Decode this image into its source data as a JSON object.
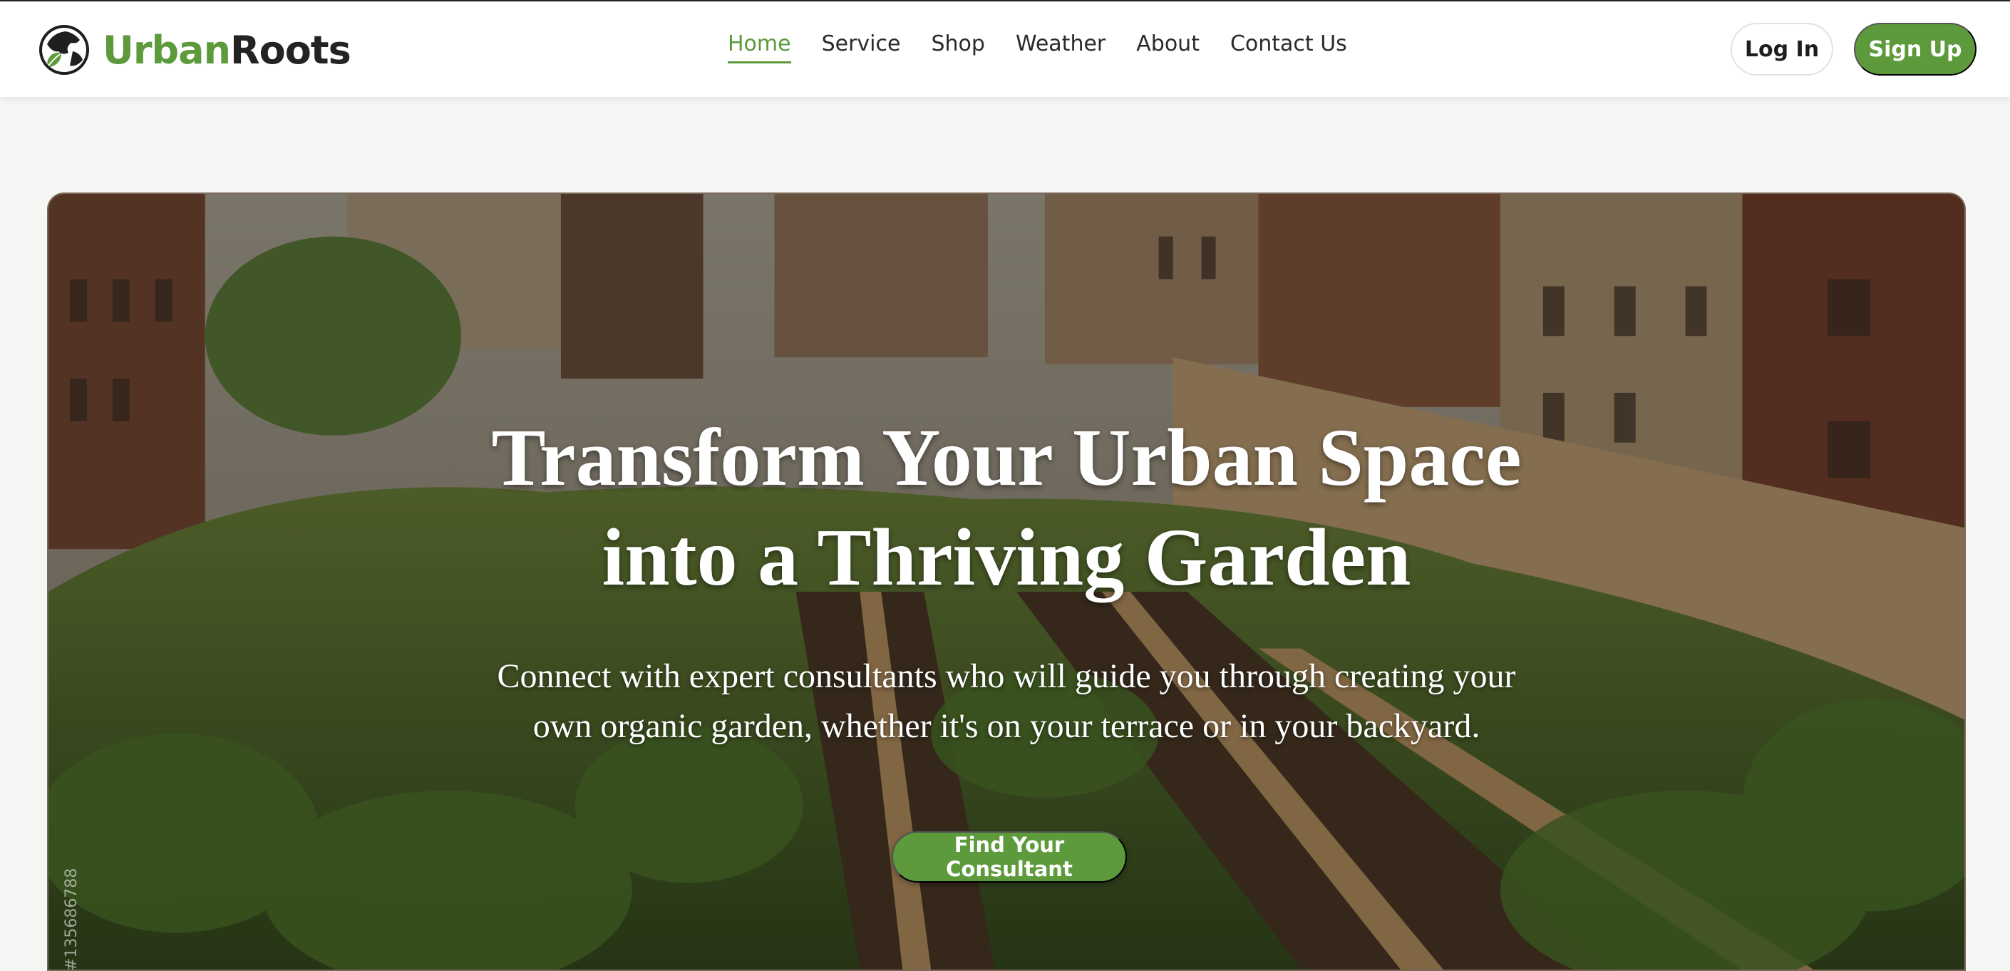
{
  "brand": {
    "name_part1": "Urban",
    "name_part2": "Roots",
    "primary_color": "#5c9a3c",
    "logo_icon": "globe-leaf-icon"
  },
  "nav": {
    "items": [
      {
        "label": "Home",
        "active": true
      },
      {
        "label": "Service",
        "active": false
      },
      {
        "label": "Shop",
        "active": false
      },
      {
        "label": "Weather",
        "active": false
      },
      {
        "label": "About",
        "active": false
      },
      {
        "label": "Contact Us",
        "active": false
      }
    ]
  },
  "auth": {
    "login_label": "Log In",
    "signup_label": "Sign Up"
  },
  "hero": {
    "title_line1": "Transform Your Urban Space",
    "title_line2": "into a Thriving Garden",
    "subtitle_line1": "Connect with expert consultants who will guide you through creating your",
    "subtitle_line2": "own organic garden, whether it's on your terrace or in your backyard.",
    "cta_label": "Find Your Consultant",
    "stock_id": "#135686788",
    "background": "rooftop garden with raised wooden beds between city buildings"
  }
}
